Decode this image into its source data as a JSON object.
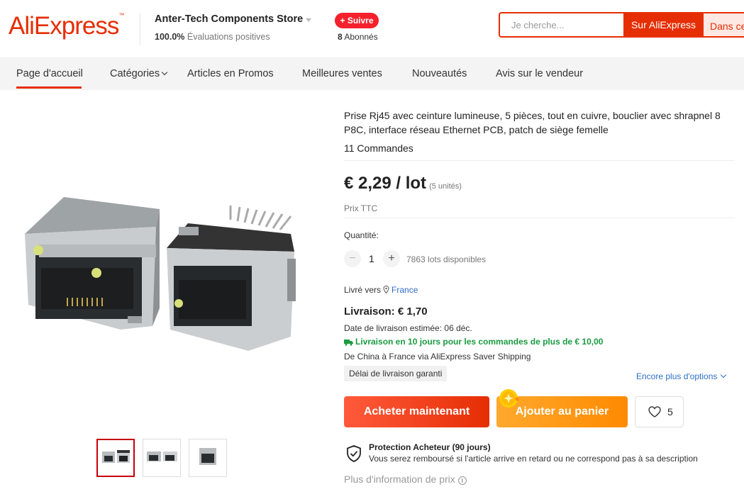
{
  "header": {
    "logo": "AliExpress",
    "store_name": "Anter-Tech Components Store",
    "rating_value": "100.0%",
    "rating_label": "Évaluations positives",
    "follow_label": "+ Suivre",
    "followers_count": "8",
    "followers_label": "Abonnés",
    "search_placeholder": "Je cherche...",
    "search_ali_label": "Sur AliExpress",
    "search_store_label": "Dans ce"
  },
  "nav": {
    "items": [
      {
        "label": "Page d'accueil"
      },
      {
        "label": "Catégories"
      },
      {
        "label": "Articles en Promos"
      },
      {
        "label": "Meilleures ventes"
      },
      {
        "label": "Nouveautés"
      },
      {
        "label": "Avis sur le vendeur"
      }
    ],
    "active": "Page d'accueil"
  },
  "product": {
    "title": "Prise Rj45 avec ceinture lumineuse, 5 pièces, tout en cuivre, bouclier avec shrapnel 8 P8C, interface réseau Ethernet PCB, patch de siège femelle",
    "orders": "11 Commandes",
    "price": "€ 2,29 / lot",
    "price_units": "(5 unités)",
    "tax_label": "Prix TTC",
    "quantity_label": "Quantité:",
    "quantity_value": "1",
    "quantity_minus": "−",
    "quantity_plus": "+",
    "available": "7863 lots disponibles",
    "ship_to_label": "Livré vers",
    "ship_to_country": "France",
    "delivery": "Livraison: € 1,70",
    "estimated": "Date de livraison estimée: 06 déc.",
    "free_shipping": "Livraison en 10 jours pour les commandes de plus de € 10,00",
    "from": "De China à France via AliExpress Saver Shipping",
    "guarantee": "Délai de livraison garanti",
    "more_options": "Encore plus d'options",
    "buy_now": "Acheter maintenant",
    "add_to_cart": "Ajouter au panier",
    "wishlist_count": "5",
    "protection_title": "Protection Acheteur (90 jours)",
    "protection_desc": "Vous serez remboursé si l'article arrive en retard ou ne correspond pas à sa description",
    "more_price_info": "Plus d'information de prix"
  },
  "colors": {
    "brand": "#e62e04",
    "buy_button": "#f5452a",
    "cart_button": "#ff9a00",
    "link": "#2e6fc7",
    "free_shipping": "#1a9b41"
  },
  "gallery": {
    "thumbnail_count": 3,
    "selected": 0
  }
}
